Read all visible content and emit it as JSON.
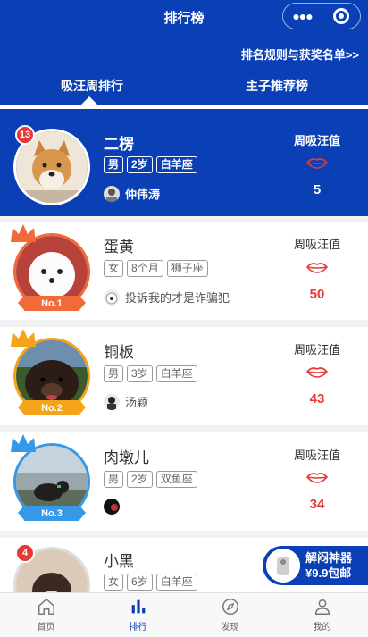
{
  "header": {
    "title": "排行榜",
    "capsule_more_icon": "more-dots-icon",
    "capsule_close_icon": "capsule-close-icon",
    "rules_link": "排名规则与获奖名单>>",
    "tabs": [
      {
        "label": "吸汪周排行",
        "active": true
      },
      {
        "label": "主子推荐榜",
        "active": false
      }
    ]
  },
  "colors": {
    "brand_blue": "#0a3fb5",
    "score_red": "#e53935",
    "gold": "#f3a418",
    "orange": "#f26a3a",
    "light_blue": "#3599e8"
  },
  "my_entry": {
    "rank": "13",
    "name": "二楞",
    "tags": [
      "男",
      "2岁",
      "白羊座"
    ],
    "owner": "仲伟涛",
    "score_label": "周吸汪值",
    "score": "5"
  },
  "entries": [
    {
      "ribbon": "No.1",
      "name": "蛋黄",
      "tags": [
        "女",
        "8个月",
        "狮子座"
      ],
      "owner": "投诉我的才是诈骗犯",
      "score_label": "周吸汪值",
      "score": "50"
    },
    {
      "ribbon": "No.2",
      "name": "铜板",
      "tags": [
        "男",
        "3岁",
        "白羊座"
      ],
      "owner": "汤颖",
      "score_label": "周吸汪值",
      "score": "43"
    },
    {
      "ribbon": "No.3",
      "name": "肉墩儿",
      "tags": [
        "男",
        "2岁",
        "双鱼座"
      ],
      "owner": "",
      "score_label": "周吸汪值",
      "score": "34"
    },
    {
      "rank": "4",
      "name": "小黑",
      "tags": [
        "女",
        "6岁",
        "白羊座"
      ]
    }
  ],
  "promo": {
    "line1": "解闷神器",
    "line2": "¥9.9包邮"
  },
  "tabbar": [
    {
      "label": "首页",
      "icon": "home-icon"
    },
    {
      "label": "排行",
      "icon": "ranking-icon",
      "active": true
    },
    {
      "label": "发现",
      "icon": "compass-icon"
    },
    {
      "label": "我的",
      "icon": "user-icon"
    }
  ]
}
